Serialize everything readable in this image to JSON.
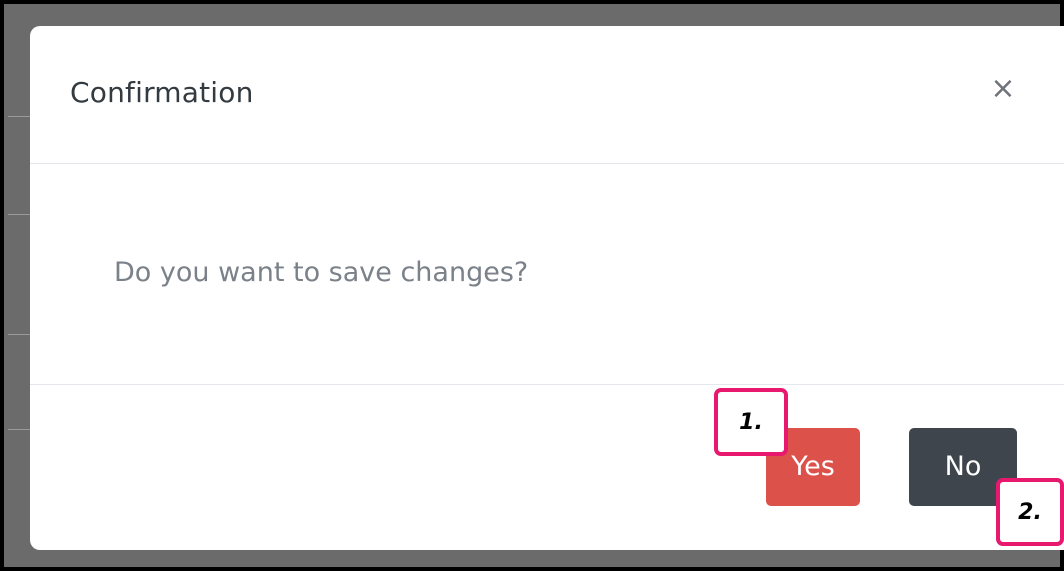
{
  "dialog": {
    "title": "Confirmation",
    "close_icon": "close-icon",
    "close_glyph": "×",
    "message": "Do you want to save changes?",
    "buttons": {
      "yes_label": "Yes",
      "no_label": "No"
    }
  },
  "annotations": {
    "marker_1": "1.",
    "marker_2": "2."
  },
  "colors": {
    "yes_button": "#dc524b",
    "no_button": "#3f454d",
    "annotation_border": "#e8186f",
    "title_text": "#333a40",
    "message_text": "#7b8189"
  }
}
